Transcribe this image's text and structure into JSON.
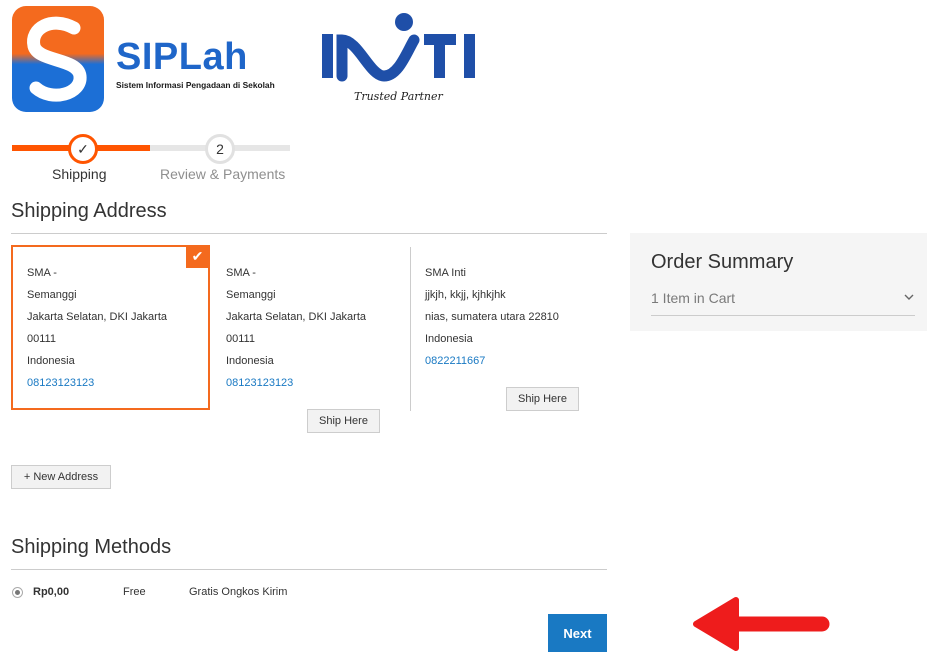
{
  "header": {
    "brand_title": "SIPLah",
    "brand_subtitle": "Sistem Informasi Pengadaan di Sekolah",
    "partner_logo_text": "INTI",
    "partner_tagline": "Trusted Partner"
  },
  "progress": {
    "steps": [
      {
        "number": "✓",
        "label": "Shipping",
        "state": "complete"
      },
      {
        "number": "2",
        "label": "Review & Payments",
        "state": "pending"
      }
    ],
    "accent_color": "#ff5501"
  },
  "shipping_address": {
    "title": "Shipping Address",
    "addresses": [
      {
        "name": "SMA -",
        "street": "Semanggi",
        "city_region": "Jakarta Selatan, DKI Jakarta",
        "postcode": "00111",
        "country": "Indonesia",
        "phone": "08123123123",
        "selected": true
      },
      {
        "name": "SMA -",
        "street": "Semanggi",
        "city_region": "Jakarta Selatan, DKI Jakarta",
        "postcode": "00111",
        "country": "Indonesia",
        "phone": "08123123123",
        "selected": false,
        "action_label": "Ship Here"
      },
      {
        "name": "SMA Inti",
        "street": "jjkjh, kkjj, kjhkjhk",
        "city_region": "nias, sumatera utara 22810",
        "country": "Indonesia",
        "phone": "0822211667",
        "selected": false,
        "action_label": "Ship Here"
      }
    ],
    "new_address_label": "+ New Address"
  },
  "order_summary": {
    "title": "Order Summary",
    "items_label": "1 Item in Cart",
    "chevron_icon": "chevron-down-icon"
  },
  "shipping_methods": {
    "title": "Shipping Methods",
    "methods": [
      {
        "price": "Rp0,00",
        "type": "Free",
        "name": "Gratis Ongkos Kirim",
        "selected": true
      }
    ]
  },
  "actions": {
    "next_label": "Next",
    "primary_color": "#1979c3"
  },
  "annotation": {
    "arrow_color": "#ee1c1c",
    "arrow_icon": "left-arrow-icon"
  }
}
